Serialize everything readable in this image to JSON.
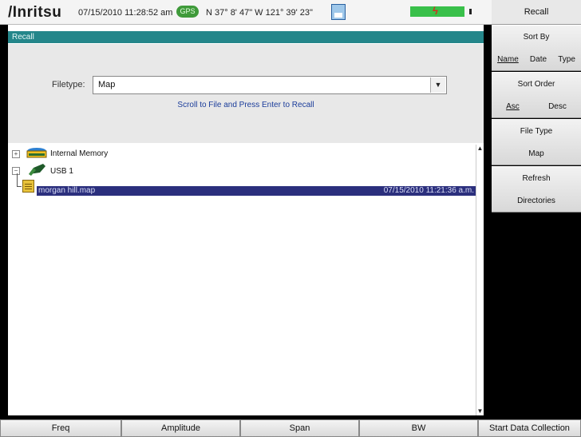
{
  "status": {
    "brand": "/Inritsu",
    "datetime": "07/15/2010 11:28:52 am",
    "gps_badge": "GPS",
    "coordinates": "N 37° 8' 47\" W 121° 39' 23\""
  },
  "recall": {
    "title": "Recall",
    "filetype_label": "Filetype:",
    "filetype_value": "Map",
    "instruction": "Scroll to File and Press Enter to Recall"
  },
  "tree": {
    "internal_memory": "Internal Memory",
    "usb": "USB 1",
    "file_name": "morgan hill.map",
    "file_date": "07/15/2010 11:21:36 a.m."
  },
  "menu": {
    "title": "Recall",
    "sort_by": "Sort By",
    "sort_name": "Name",
    "sort_date": "Date",
    "sort_type": "Type",
    "sort_order": "Sort Order",
    "order_asc": "Asc",
    "order_desc": "Desc",
    "file_type": "File Type",
    "file_type_value": "Map",
    "refresh_line1": "Refresh",
    "refresh_line2": "Directories"
  },
  "bottom": {
    "freq": "Freq",
    "amplitude": "Amplitude",
    "span": "Span",
    "bw": "BW",
    "start_data": "Start Data Collection"
  },
  "colors": {
    "title_bar": "#24868a",
    "selection": "#2b2f7d",
    "gps": "#3f9a3a",
    "battery": "#39c04a"
  }
}
